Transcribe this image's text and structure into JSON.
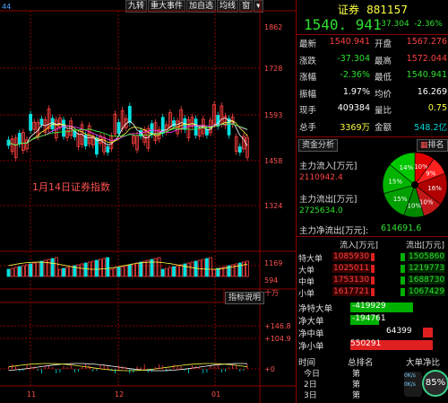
{
  "left_panel": {
    "corner_label": "44",
    "annotation": "1月14日证券指数",
    "toolbar": [
      "九转",
      "重大事件",
      "加自选",
      "均线",
      "窗"
    ],
    "price_axis": [
      "1862",
      "1728",
      "1593",
      "1458",
      "1324"
    ],
    "volume_axis": [
      "1169",
      "594",
      "十万"
    ],
    "indicator_axis": [
      "+146.8",
      "+104.9",
      "+0"
    ],
    "indicator_button": "指标说明",
    "date_axis": [
      "11",
      "12",
      "01"
    ]
  },
  "quote": {
    "name": "证券",
    "code": "881157",
    "price": "1540. 941",
    "change": "-37.304",
    "change_pct": "-2.36%",
    "rows": [
      {
        "l1": "最新",
        "v1": "1540.941",
        "c1": "red",
        "l2": "开盘",
        "v2": "1567.276",
        "c2": "red"
      },
      {
        "l1": "涨跌",
        "v1": "-37.304",
        "c1": "grn",
        "l2": "最高",
        "v2": "1572.044",
        "c2": "red"
      },
      {
        "l1": "涨幅",
        "v1": "-2.36%",
        "c1": "grn",
        "l2": "最低",
        "v2": "1540.941",
        "c2": "grn"
      },
      {
        "l1": "振幅",
        "v1": "1.97%",
        "c1": "wht",
        "l2": "均价",
        "v2": "16.269",
        "c2": "wht"
      },
      {
        "l1": "现手",
        "v1": "409384",
        "c1": "wht",
        "l2": "量比",
        "v2": "0.75",
        "c2": "yel"
      },
      {
        "l1": "总手",
        "v1": "3369万",
        "c1": "yel",
        "l2": "金额",
        "v2": "548.2亿",
        "c2": "cyan"
      }
    ]
  },
  "funds": {
    "tab_analysis": "资金分析",
    "tab_rank": "排名",
    "inflow_label": "主力流入[万元]",
    "inflow_value": "2110942.4",
    "outflow_label": "主力流出[万元]",
    "outflow_value": "2725634.0",
    "net_label": "主力净流出[万元]:",
    "net_value": "614691.6",
    "pie": [
      {
        "label": "10%",
        "value": 10,
        "color": "#e00000"
      },
      {
        "label": "9%",
        "value": 9,
        "color": "#ff2020"
      },
      {
        "label": "16%",
        "value": 16,
        "color": "#b00000"
      },
      {
        "label": "10%",
        "value": 10,
        "color": "#c01818"
      },
      {
        "label": "10%",
        "value": 10,
        "color": "#008800"
      },
      {
        "label": "15%",
        "value": 15,
        "color": "#00a000"
      },
      {
        "label": "15%",
        "value": 15,
        "color": "#00b400"
      },
      {
        "label": "14%",
        "value": 14,
        "color": "#00c800"
      }
    ],
    "table_header": [
      "流入[万元]",
      "流出[万元]"
    ],
    "table": [
      {
        "name": "特大单",
        "in": "1085930",
        "out": "1505860"
      },
      {
        "name": "大单",
        "in": "1025011",
        "out": "1219773"
      },
      {
        "name": "中单",
        "in": "1753130",
        "out": "1688730"
      },
      {
        "name": "小单",
        "in": "1617721",
        "out": "1067429"
      }
    ],
    "net": [
      {
        "name": "净特大单",
        "value": "-419929",
        "ratio": 0.76,
        "color": "#00b000"
      },
      {
        "name": "净大单",
        "value": "-194761",
        "ratio": 0.35,
        "color": "#00b000"
      },
      {
        "name": "净中单",
        "value": "64399",
        "ratio": 0.12,
        "color": "#e02020"
      },
      {
        "name": "净小单",
        "value": "550291",
        "ratio": 1.0,
        "color": "#e02020"
      }
    ],
    "history_header": [
      "时间",
      "总排名",
      "大单净比"
    ],
    "history": [
      {
        "time": "今日",
        "rank": "第"
      },
      {
        "time": "2日",
        "rank": "第"
      },
      {
        "time": "3日",
        "rank": "第"
      }
    ],
    "speed": {
      "percent": "85%",
      "up": "0K/s",
      "down": "0K/s"
    }
  }
}
